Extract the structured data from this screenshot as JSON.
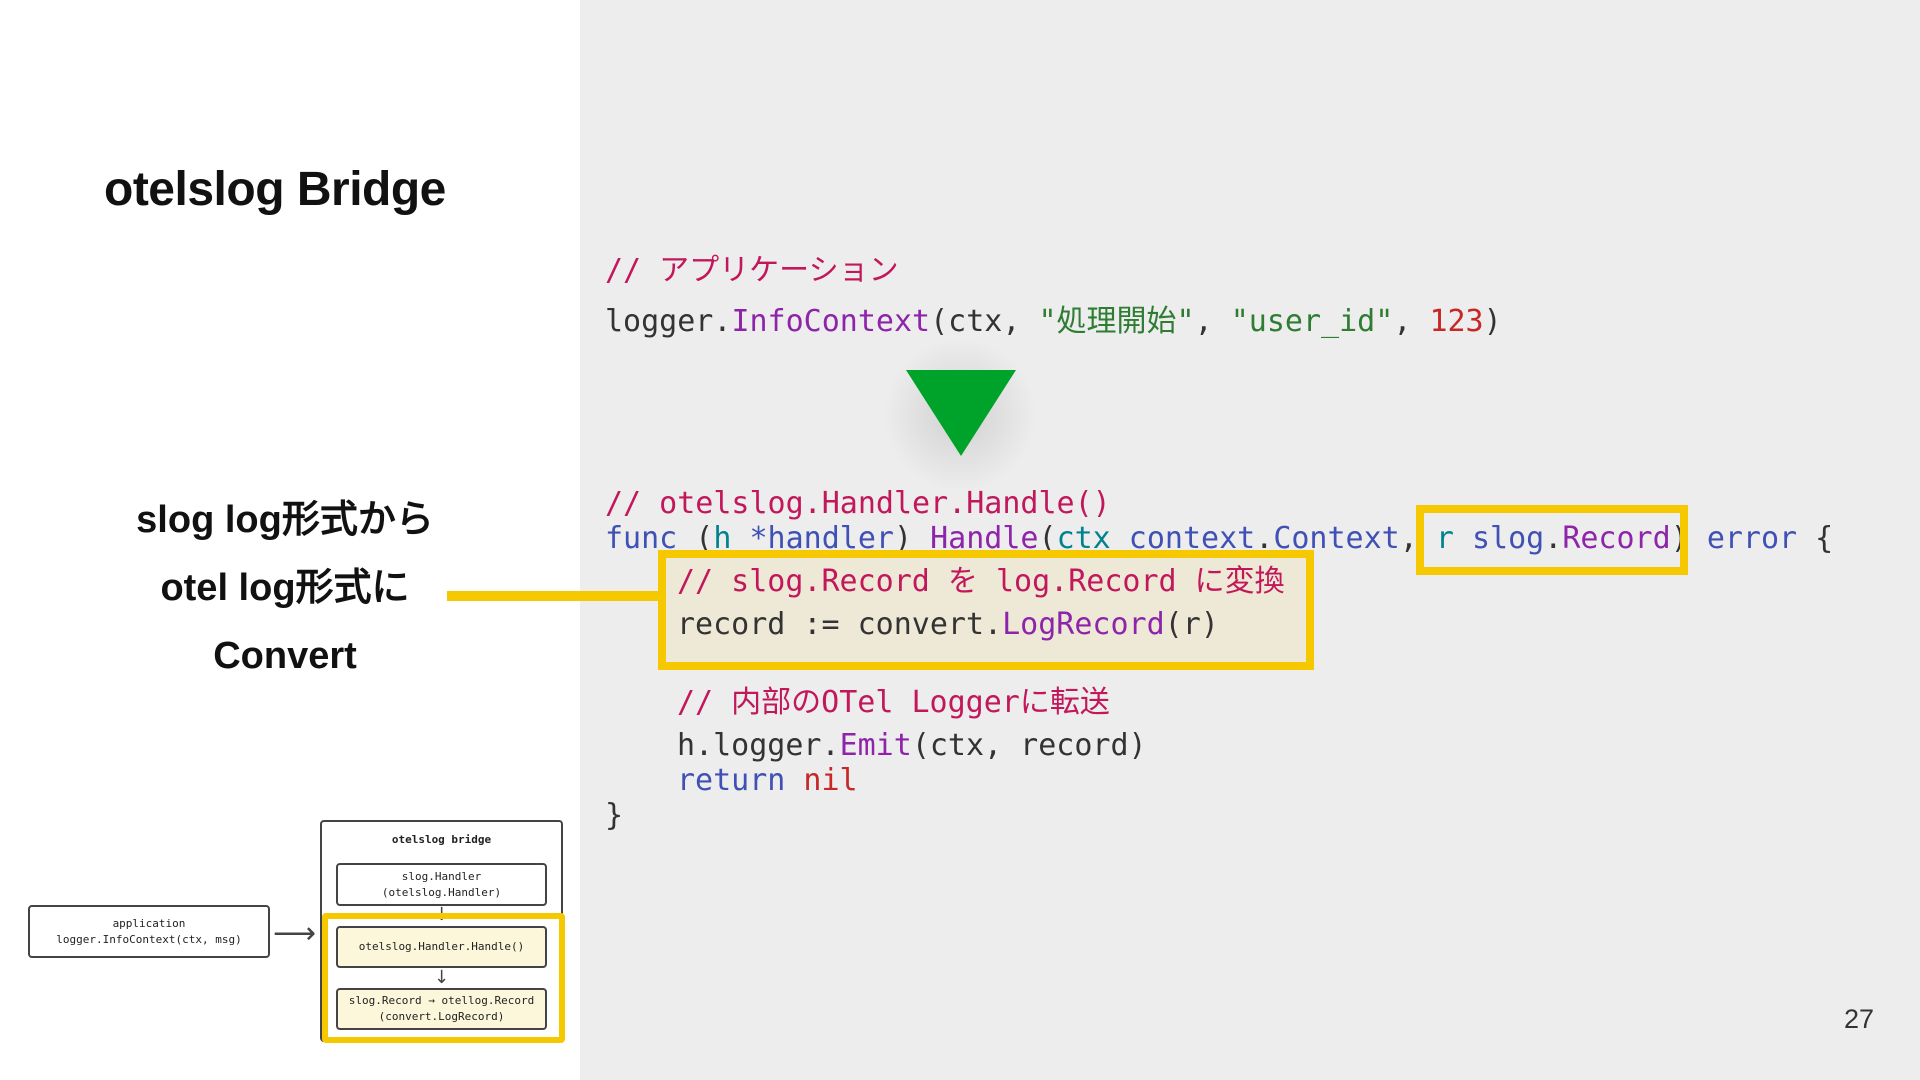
{
  "slide": {
    "title": "otelslog Bridge",
    "page_number": "27",
    "caption": [
      "slog log形式から",
      "otel log形式に",
      "Convert"
    ]
  },
  "code_top": {
    "comment": "// アプリケーション",
    "line": {
      "obj": "logger.",
      "fn": "InfoContext",
      "open": "(ctx, ",
      "str1": "\"処理開始\"",
      "sep": ", ",
      "str2": "\"user_id\"",
      "sep2": ", ",
      "num": "123",
      "close": ")"
    }
  },
  "code_bottom": {
    "comment1": "// otelslog.Handler.Handle()",
    "sig": {
      "kw_func": "func",
      "p1": " (",
      "recv": "h",
      "recv_type": " *handler",
      "p2": ") ",
      "name": "Handle",
      "p3": "(",
      "ctx": "ctx",
      "ctx_type": " context",
      "dot": ".",
      "ctx_type2": "Context",
      "comma": ", ",
      "r": "r",
      "r_type": " slog",
      "dot2": ".",
      "r_type2": "Record",
      "p4": ") ",
      "ret": "error",
      "brace": " {"
    },
    "comment2": "// slog.Record を log.Record に変換",
    "convert_line": {
      "pre": "record := convert.",
      "fn": "LogRecord",
      "post": "(r)"
    },
    "comment3": "// 内部のOTel Loggerに転送",
    "emit_line": {
      "pre": "h.logger.",
      "fn": "Emit",
      "post": "(ctx, record)"
    },
    "return_line": {
      "kw": "return",
      "val": " nil"
    },
    "close_brace": "}"
  },
  "diagram": {
    "outer_title": "otelslog bridge",
    "app_line1": "application",
    "app_line2": "logger.InfoContext(ctx, msg)",
    "handler_line1": "slog.Handler",
    "handler_line2": "(otelslog.Handler)",
    "handle_label": "otelslog.Handler.Handle()",
    "convert_line1": "slog.Record → otellog.Record",
    "convert_line2": "(convert.LogRecord)",
    "arrow_right": "⟶",
    "arrow_down": "↓"
  },
  "colors": {
    "highlight": "#f5c800",
    "arrow": "#00a32a",
    "right_panel_bg": "#ededed"
  }
}
